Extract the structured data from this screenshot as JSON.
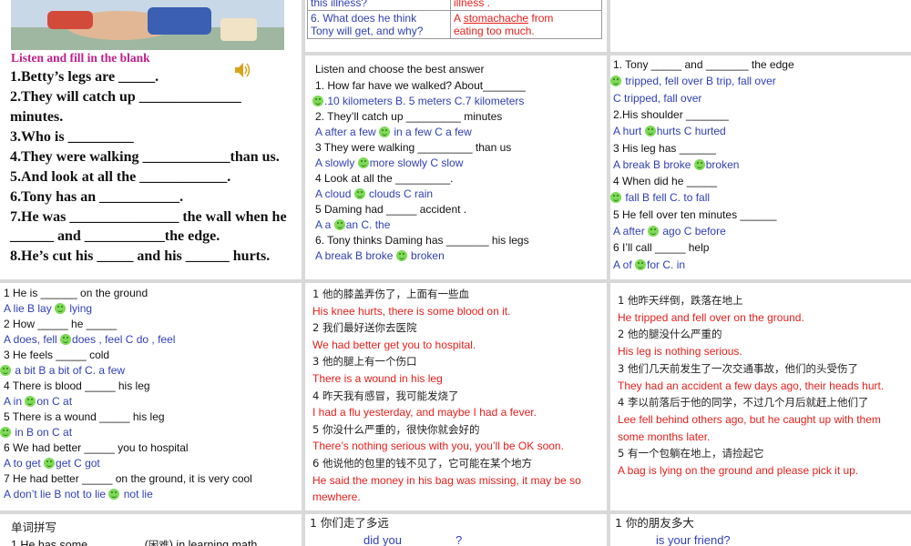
{
  "p1": {
    "title": "Listen and fill in the blank",
    "lines": [
      "1.Betty’s legs are _____.",
      "2.They will catch up ______________",
      "minutes.",
      "3.Who  is _________",
      "4.They were walking ____________than us.",
      "5.And look at all the ____________.",
      "6.Tony has an ___________.",
      "7.He was _______________ the wall when he",
      "______ and ___________the edge.",
      "8.He’s cut his _____ and his ______ hurts."
    ]
  },
  "p2": {
    "r1q": "this illness?",
    "r1a": "illness .",
    "r2q1": "6. What does he think",
    "r2q2": "Tony will get, and why?",
    "r2a1": "A ",
    "r2a1u": "stomachache",
    "r2a1t": " from",
    "r2a2": "eating too much."
  },
  "p5": {
    "title": "Listen and choose the best answer",
    "lines": [
      {
        "t": "1.   How far have we walked? About_______",
        "c": "blk"
      },
      {
        "t": ".10 kilometers    B. 5 meters   C.7 kilometers",
        "c": "blu",
        "s": 1
      },
      {
        "t": "2. They’ll catch up _________ minutes",
        "c": "blk"
      },
      {
        "t": "A after a few   ",
        "t2": " in a few   C a few",
        "c": "blu",
        "s2": 1
      },
      {
        "t": "3 They were walking _________ than us",
        "c": "blk"
      },
      {
        "t": "A  slowly  ",
        "t2": "more slowly   C slow",
        "c": "blu",
        "s2": 1
      },
      {
        "t": "4 Look at all the _________.",
        "c": "blk"
      },
      {
        "t": "A  cloud   ",
        "t2": " clouds    C rain",
        "c": "blu",
        "s2": 1
      },
      {
        "t": "5 Daming had _____ accident .",
        "c": "blk"
      },
      {
        "t": "A   a       ",
        "t2": "an     C. the",
        "c": "blu",
        "s2": 1
      },
      {
        "t": "6. Tony thinks Daming has _______ his legs",
        "c": "blk"
      },
      {
        "t": "A  break   B   broke    ",
        "t2": " broken",
        "c": "blu",
        "s2": 1
      }
    ]
  },
  "p3": {
    "lines": [
      {
        "t": "1.   Tony _____ and _______ the edge",
        "c": "blk"
      },
      {
        "t": " tripped, fell over    B trip, fall over",
        "c": "blu",
        "s": 1
      },
      {
        "t": "C tripped,  fall over",
        "c": "blu"
      },
      {
        "t": "2.His shoulder _______",
        "c": "blk"
      },
      {
        "t": "A  hurt    ",
        "t2": "hurts    C hurted",
        "c": "blu",
        "s2": 1
      },
      {
        "t": "3 His leg has ______",
        "c": "blk"
      },
      {
        "t": "A break   B broke   ",
        "t2": "broken",
        "c": "blu",
        "s2": 1
      },
      {
        "t": "4 When did he _____",
        "c": "blk"
      },
      {
        "t": " fall     B fell    C. to fall",
        "c": "blu",
        "s": 1
      },
      {
        "t": "5 He fell over ten minutes ______",
        "c": "blk"
      },
      {
        "t": "A after    ",
        "t2": " ago     C before",
        "c": "blu",
        "s2": 1
      },
      {
        "t": "6 I’ll call _____ help",
        "c": "blk"
      },
      {
        "t": "A of      ",
        "t2": "for     C. in",
        "c": "blu",
        "s2": 1
      }
    ]
  },
  "p4": {
    "lines": [
      {
        "t": "1 He is ______ on the ground",
        "c": "blk"
      },
      {
        "t": "A   lie     B lay    ",
        "t2": " lying",
        "c": "blu",
        "s2": 1
      },
      {
        "t": "2 How _____ he _____",
        "c": "blk"
      },
      {
        "t": "A does, fell    ",
        "t2": "does , feel    C do , feel",
        "c": "blu",
        "s2": 1
      },
      {
        "t": "3 He feels _____ cold",
        "c": "blk"
      },
      {
        "t": " a bit    B a bit of    C. a few",
        "c": "blu",
        "s": 1
      },
      {
        "t": "4 There is blood _____ his leg",
        "c": "blk"
      },
      {
        "t": "A   in   ",
        "t2": "on     C at",
        "c": "blu",
        "s2": 1
      },
      {
        "t": "5 There is a wound _____ his leg",
        "c": "blk"
      },
      {
        "t": " in     B on    C at",
        "c": "blu",
        "s": 1
      },
      {
        "t": "6 We had better _____ you to hospital",
        "c": "blk"
      },
      {
        "t": "A to get    ",
        "t2": "get     C got",
        "c": "blu",
        "s2": 1
      },
      {
        "t": "7 He had better _____ on the ground, it is very cool",
        "c": "blk"
      },
      {
        "t": "A  don’t lie    B not to lie     ",
        "t2": " not lie",
        "c": "blu",
        "s2": 1
      }
    ]
  },
  "p6": {
    "lines": [
      {
        "t": "1  他的膝盖弄伤了，上面有一些血",
        "c": "cn"
      },
      {
        "t": "His knee hurts, there is some blood on it.",
        "c": "red"
      },
      {
        "t": "2  我们最好送你去医院",
        "c": "cn"
      },
      {
        "t": "We had better get you to hospital.",
        "c": "red"
      },
      {
        "t": "3  他的腿上有一个伤口",
        "c": "cn"
      },
      {
        "t": "There is a wound in his leg",
        "c": "red"
      },
      {
        "t": "4  昨天我有感冒，我可能发烧了",
        "c": "cn"
      },
      {
        "t": "I had a flu yesterday, and maybe I had a fever.",
        "c": "red"
      },
      {
        "t": "5  你没什么严重的，很快你就会好的",
        "c": "cn"
      },
      {
        "t": "There’s nothing serious with you, you’ll be OK soon.",
        "c": "red"
      },
      {
        "t": "6  他说他的包里的钱不见了，它可能在某个地方",
        "c": "cn"
      },
      {
        "t": "He said the money in his bag was missing, it may be so",
        "c": "red"
      },
      {
        "t": "   mewhere.",
        "c": "red"
      }
    ]
  },
  "p7": {
    "lines": [
      {
        "t": "1 他昨天绊倒，跌落在地上",
        "c": "cn"
      },
      {
        "t": "He tripped and fell over on the ground.",
        "c": "red"
      },
      {
        "t": "2  他的腿没什么严重的",
        "c": "cn"
      },
      {
        "t": "His leg is nothing serious.",
        "c": "red"
      },
      {
        "t": "3  他们几天前发生了一次交通事故，他们的头受伤了",
        "c": "cn"
      },
      {
        "t": "They had an accident a few days ago, their heads hurt.",
        "c": "red"
      },
      {
        "t": "4  李以前落后于他的同学，不过几个月后就赶上他们了",
        "c": "cn"
      },
      {
        "t": "Lee fell behind others ago, but he caught up with them",
        "c": "red"
      },
      {
        "t": "   some months later.",
        "c": "red"
      },
      {
        "t": "5  有一个包躺在地上，请捡起它",
        "c": "cn"
      },
      {
        "t": "A bag is lying on the ground and please pick it up.",
        "c": "red"
      }
    ]
  },
  "p8": {
    "l1": "单词拼写",
    "l2a": "1 He has some ________ (",
    "l2b": "困难",
    "l2c": ") in learning math"
  },
  "p9": {
    "l1": "1  你们走了多远",
    "l2": "did you",
    "l3": "?"
  },
  "p10": {
    "l1": "1  你的朋友多大",
    "l2": "is your friend?"
  },
  "colors": {
    "question": "#111111",
    "choice": "#2f3fb5",
    "answer": "#e8201c",
    "heading": "#c0208a",
    "smiley": "#7ed957"
  }
}
